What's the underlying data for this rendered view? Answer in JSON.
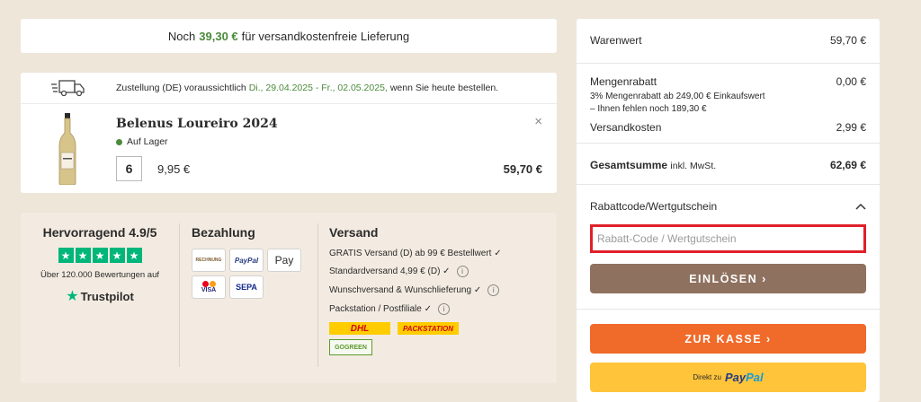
{
  "banner": {
    "prefix": "Noch",
    "amount": "39,30 €",
    "suffix": "für versandkostenfreie Lieferung"
  },
  "item": {
    "delivery_prefix": "Zustellung (DE) voraussichtlich",
    "delivery_dates": "Di., 29.04.2025 - Fr., 02.05.2025,",
    "delivery_suffix": "wenn Sie heute bestellen.",
    "name": "Belenus Loureiro 2024",
    "stock": "Auf Lager",
    "quantity": "6",
    "unit_price": "9,95 €",
    "line_price": "59,70 €",
    "remove_icon": "×"
  },
  "trust": {
    "heading": "Hervorragend 4.9/5",
    "reviews": "Über 120.000 Bewertungen auf",
    "logo_text": "Trustpilot"
  },
  "payment": {
    "heading": "Bezahlung",
    "methods": [
      "RECHNUNG",
      "PayPal",
      " Pay",
      "VISA",
      "SEPA"
    ]
  },
  "shipping": {
    "heading": "Versand",
    "lines": [
      "GRATIS Versand (D) ab 99 € Bestellwert ✓",
      "Standardversand 4,99 € (D) ✓",
      "Wunschversand & Wunschlieferung ✓",
      "Packstation / Postfiliale ✓"
    ],
    "carriers": [
      "DHL",
      "PACKSTATION"
    ],
    "gogreen": "GOGREEN"
  },
  "summary": {
    "goods_label": "Warenwert",
    "goods_value": "59,70 €",
    "discount_label": "Mengenrabatt",
    "discount_value": "0,00 €",
    "discount_note1": "3% Mengenrabatt ab 249,00 € Einkaufswert",
    "discount_note2": "– Ihnen fehlen noch 189,30 €",
    "shipping_label": "Versandkosten",
    "shipping_value": "2,99 €",
    "total_label": "Gesamtsumme",
    "total_suffix": "inkl. MwSt.",
    "total_value": "62,69 €",
    "coupon_heading": "Rabattcode/Wertgutschein",
    "coupon_placeholder": "Rabatt-Code / Wertgutschein",
    "redeem_label": "EINLÖSEN  ›",
    "checkout_label": "ZUR KASSE  ›",
    "paypal_prefix": "Direkt zu",
    "paypal_p1": "Pay",
    "paypal_p2": "Pal"
  },
  "colors": {
    "accent_green": "#4b8a3a",
    "checkout": "#f06a2a",
    "redeem": "#8f715f",
    "paypal": "#ffc439",
    "trustpilot": "#00b67a"
  }
}
